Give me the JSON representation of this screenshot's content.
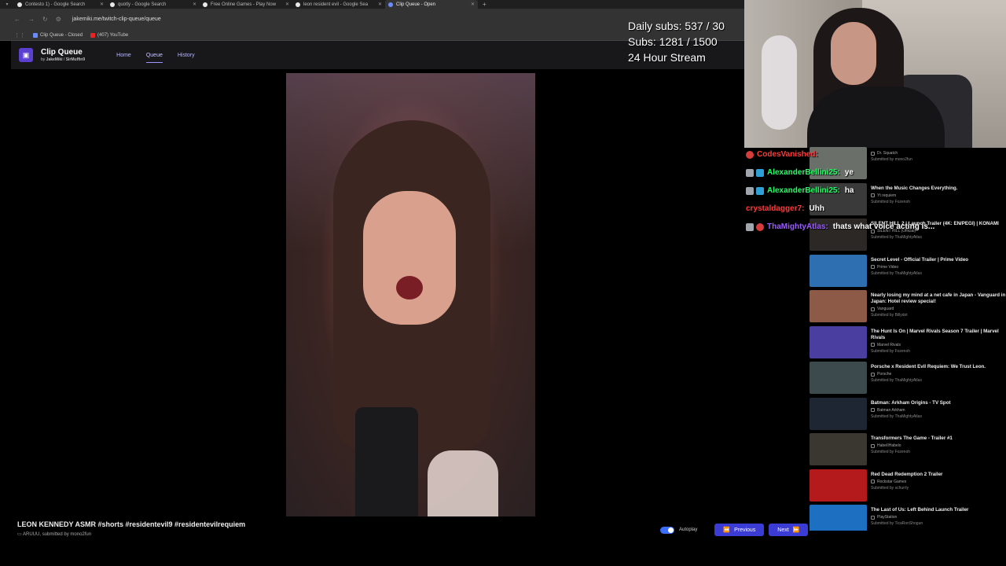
{
  "browser": {
    "tabs": [
      {
        "label": "Contesto 1) - Google Search",
        "active": false
      },
      {
        "label": "quotly - Google Search",
        "active": false
      },
      {
        "label": "Free Online Games - Play Now",
        "active": false
      },
      {
        "label": "leon resident evil - Google Sea",
        "active": false
      },
      {
        "label": "Clip Queue - Open",
        "active": true
      }
    ],
    "url": "jakemiki.me/twitch-clip-queue/queue",
    "bookmarks": [
      {
        "label": "Clip Queue - Closed",
        "icon": "clip-queue-icon"
      },
      {
        "label": "(407) YouTube",
        "icon": "youtube-icon"
      }
    ]
  },
  "app": {
    "name": "Clip Queue",
    "by_prefix": "by",
    "author1": "JakeMiki",
    "author_sep": "/",
    "author2": "SirMuffin9",
    "nav": [
      {
        "label": "Home",
        "active": false
      },
      {
        "label": "Queue",
        "active": true
      },
      {
        "label": "History",
        "active": false
      }
    ]
  },
  "overlay": {
    "line1": "Daily subs: 537 / 30",
    "line2": "Subs: 1281 / 1500",
    "line3": "24 Hour Stream"
  },
  "current_clip": {
    "title": "LEON KENNEDY ASMR #shorts #residentevil9 #residentevilrequiem",
    "channel": "ARUUU",
    "submitted_label": "submitted by",
    "submitter": "mono2fun"
  },
  "controls": {
    "autoplay_label": "Autoplay",
    "autoplay_on": true,
    "previous_label": "Previous",
    "next_label": "Next"
  },
  "chat": [
    {
      "user": "CodesVanished:",
      "msg": "",
      "color": "#ff3b3b",
      "badges": [
        "sub"
      ]
    },
    {
      "user": "AlexanderBellini25:",
      "msg": "ye",
      "color": "#22ff66",
      "badges": [
        "sword",
        "mod"
      ]
    },
    {
      "user": "AlexanderBellini25:",
      "msg": "ha",
      "color": "#22ff66",
      "badges": [
        "sword",
        "mod"
      ]
    },
    {
      "user": "crystaldagger7:",
      "msg": "Uhh",
      "color": "#ff3b3b",
      "badges": []
    },
    {
      "user": "ThaMightyAtlas:",
      "msg": "thats what voice acting is...",
      "color": "#9b5cff",
      "badges": [
        "sword",
        "sub"
      ]
    }
  ],
  "queue": [
    {
      "title": "",
      "channel": "Dr. Squatch",
      "submitter": "Submitted by mono2fun",
      "thumb": "#6b6f6a"
    },
    {
      "title": "When the Music Changes Everything.",
      "channel": "Yt requiem",
      "submitter": "Submitted by Fozenoh",
      "thumb": "#3a3a3a"
    },
    {
      "title": "SILENT HILL 2 | Launch Trailer (4K: EN/PEGI) | KONAMI",
      "channel": "SILENT HILL (Official)",
      "submitter": "Submitted by ThaMightyAtlas",
      "thumb": "#2c2826"
    },
    {
      "title": "Secret Level - Official Trailer | Prime Video",
      "channel": "Prime Video",
      "submitter": "Submitted by ThaMightyAtlas",
      "thumb": "#2d6fb0"
    },
    {
      "title": "Nearly losing my mind at a net cafe in Japan - Vanguard in Japan: Hotel review special!",
      "channel": "Vanguard",
      "submitter": "Submitted by Billydot",
      "thumb": "#8c5a46"
    },
    {
      "title": "The Hunt Is On | Marvel Rivals Season 7 Trailer | Marvel Rivals",
      "channel": "Marvel Rivals",
      "submitter": "Submitted by Fozenoh",
      "thumb": "#4a3fa0"
    },
    {
      "title": "Porsche x Resident Evil Requiem: We Trust Leon.",
      "channel": "Porsche",
      "submitter": "Submitted by ThaMightyAtlas",
      "thumb": "#3c4a4e"
    },
    {
      "title": "Batman: Arkham Origins - TV Spot",
      "channel": "Batman Arkham",
      "submitter": "Submitted by ThaMightyAtlas",
      "thumb": "#1f2633"
    },
    {
      "title": "Transformers The Game - Trailer #1",
      "channel": "HabeIIHabelo",
      "submitter": "Submitted by Fozenoh",
      "thumb": "#3a3630"
    },
    {
      "title": "Red Dead Redemption 2 Trailer",
      "channel": "Rockstar Games",
      "submitter": "Submitted by schurrly",
      "thumb": "#b4191b"
    },
    {
      "title": "The Last of Us: Left Behind Launch Trailer",
      "channel": "PlayStation",
      "submitter": "Submitted by TicaRonShogun",
      "thumb": "#1d6fc2"
    }
  ]
}
